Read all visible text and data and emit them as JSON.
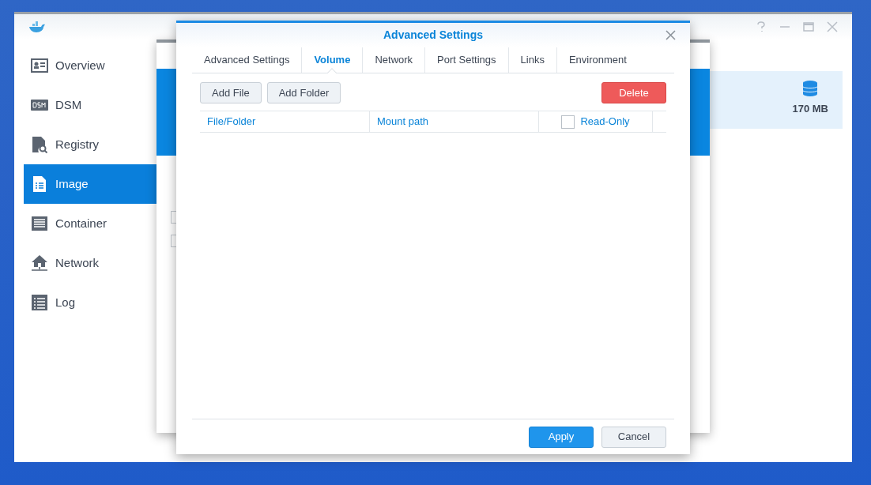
{
  "sidebar": {
    "items": [
      {
        "label": "Overview",
        "selected": false
      },
      {
        "label": "DSM",
        "selected": false
      },
      {
        "label": "Registry",
        "selected": false
      },
      {
        "label": "Image",
        "selected": true
      },
      {
        "label": "Container",
        "selected": false
      },
      {
        "label": "Network",
        "selected": false
      },
      {
        "label": "Log",
        "selected": false
      }
    ]
  },
  "storage": {
    "size": "170 MB"
  },
  "background_dialog": {
    "checkboxes": [
      {
        "checked": false
      },
      {
        "checked": false
      }
    ]
  },
  "dialog": {
    "title": "Advanced Settings",
    "tabs": [
      {
        "label": "Advanced Settings",
        "selected": false
      },
      {
        "label": "Volume",
        "selected": true
      },
      {
        "label": "Network",
        "selected": false
      },
      {
        "label": "Port Settings",
        "selected": false
      },
      {
        "label": "Links",
        "selected": false
      },
      {
        "label": "Environment",
        "selected": false
      }
    ],
    "toolbar": {
      "add_file": "Add File",
      "add_folder": "Add Folder",
      "delete": "Delete"
    },
    "table": {
      "columns": [
        {
          "label": "File/Folder",
          "kind": "text"
        },
        {
          "label": "Mount path",
          "kind": "text"
        },
        {
          "label": "Read-Only",
          "kind": "checkbox",
          "checked": false
        }
      ]
    },
    "buttons": {
      "apply": "Apply",
      "cancel": "Cancel"
    }
  }
}
